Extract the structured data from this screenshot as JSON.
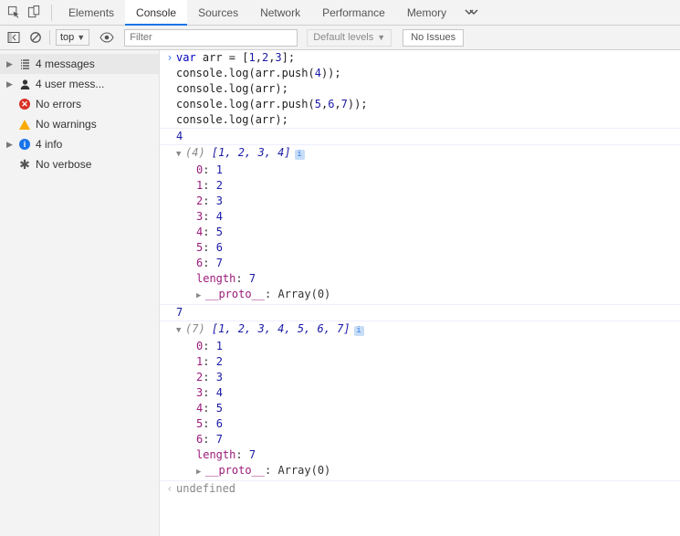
{
  "tabs": {
    "elements": "Elements",
    "console": "Console",
    "sources": "Sources",
    "network": "Network",
    "performance": "Performance",
    "memory": "Memory"
  },
  "toolbar": {
    "context": "top",
    "filter_placeholder": "Filter",
    "levels": "Default levels",
    "issues": "No Issues"
  },
  "sidebar": {
    "messages": "4 messages",
    "user": "4 user mess...",
    "errors": "No errors",
    "warnings": "No warnings",
    "info": "4 info",
    "verbose": "No verbose"
  },
  "code": {
    "l1a": "var",
    "l1b": " arr = [",
    "l1c": "1",
    "l1d": ",",
    "l1e": "2",
    "l1f": ",",
    "l1g": "3",
    "l1h": "];",
    "l2a": "console.log(arr.push(",
    "l2b": "4",
    "l2c": "));",
    "l3": "console.log(arr);",
    "l4a": "console.log(arr.push(",
    "l4b": "5",
    "l4c": ",",
    "l4d": "6",
    "l4e": ",",
    "l4f": "7",
    "l4g": "));",
    "l5": "console.log(arr);"
  },
  "out": {
    "four": "4",
    "seven": "7",
    "undefined": "undefined",
    "arr1_len": "(4) ",
    "arr1_body": "[1, 2, 3, 4]",
    "arr2_len": "(7) ",
    "arr2_body": "[1, 2, 3, 4, 5, 6, 7]",
    "entries": [
      {
        "k": "0",
        "v": "1"
      },
      {
        "k": "1",
        "v": "2"
      },
      {
        "k": "2",
        "v": "3"
      },
      {
        "k": "3",
        "v": "4"
      },
      {
        "k": "4",
        "v": "5"
      },
      {
        "k": "5",
        "v": "6"
      },
      {
        "k": "6",
        "v": "7"
      }
    ],
    "length_label": "length",
    "length_value": "7",
    "proto_label": "__proto__",
    "proto_value": "Array(0)"
  }
}
